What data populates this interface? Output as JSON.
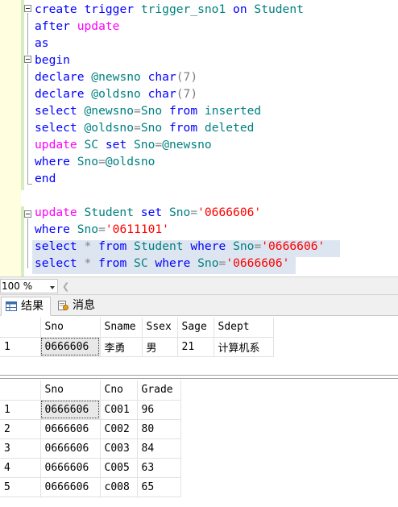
{
  "editor": {
    "lines": [
      [
        {
          "t": "create",
          "c": "kw"
        },
        {
          "t": " ",
          "c": ""
        },
        {
          "t": "trigger",
          "c": "kw"
        },
        {
          "t": " trigger_sno1 ",
          "c": "tl"
        },
        {
          "t": "on",
          "c": "kw"
        },
        {
          "t": " Student",
          "c": "tl"
        }
      ],
      [
        {
          "t": "after",
          "c": "kw"
        },
        {
          "t": " ",
          "c": ""
        },
        {
          "t": "update",
          "c": "pk"
        }
      ],
      [
        {
          "t": "as",
          "c": "kw"
        }
      ],
      [
        {
          "t": "begin",
          "c": "kw"
        }
      ],
      [
        {
          "t": "declare",
          "c": "kw"
        },
        {
          "t": " @newsno ",
          "c": "tl"
        },
        {
          "t": "char",
          "c": "kw"
        },
        {
          "t": "(7)",
          "c": "gy"
        }
      ],
      [
        {
          "t": "declare",
          "c": "kw"
        },
        {
          "t": " @oldsno ",
          "c": "tl"
        },
        {
          "t": "char",
          "c": "kw"
        },
        {
          "t": "(7)",
          "c": "gy"
        }
      ],
      [
        {
          "t": "select",
          "c": "kw"
        },
        {
          "t": " @newsno",
          "c": "tl"
        },
        {
          "t": "=",
          "c": "gy"
        },
        {
          "t": "Sno ",
          "c": "tl"
        },
        {
          "t": "from",
          "c": "kw"
        },
        {
          "t": " inserted",
          "c": "tl"
        }
      ],
      [
        {
          "t": "select",
          "c": "kw"
        },
        {
          "t": " @oldsno",
          "c": "tl"
        },
        {
          "t": "=",
          "c": "gy"
        },
        {
          "t": "Sno ",
          "c": "tl"
        },
        {
          "t": "from",
          "c": "kw"
        },
        {
          "t": " deleted",
          "c": "tl"
        }
      ],
      [
        {
          "t": "update",
          "c": "pk"
        },
        {
          "t": " SC ",
          "c": "tl"
        },
        {
          "t": "set",
          "c": "kw"
        },
        {
          "t": " Sno",
          "c": "tl"
        },
        {
          "t": "=",
          "c": "gy"
        },
        {
          "t": "@newsno",
          "c": "tl"
        }
      ],
      [
        {
          "t": "where",
          "c": "kw"
        },
        {
          "t": " Sno",
          "c": "tl"
        },
        {
          "t": "=",
          "c": "gy"
        },
        {
          "t": "@oldsno",
          "c": "tl"
        }
      ],
      [
        {
          "t": "end",
          "c": "kw"
        }
      ],
      [],
      [
        {
          "t": "update",
          "c": "pk"
        },
        {
          "t": " Student ",
          "c": "tl"
        },
        {
          "t": "set",
          "c": "kw"
        },
        {
          "t": " Sno",
          "c": "tl"
        },
        {
          "t": "=",
          "c": "gy"
        },
        {
          "t": "'0666606'",
          "c": "st"
        }
      ],
      [
        {
          "t": "where",
          "c": "kw"
        },
        {
          "t": " Sno",
          "c": "tl"
        },
        {
          "t": "=",
          "c": "gy"
        },
        {
          "t": "'0611101'",
          "c": "st"
        }
      ],
      [
        {
          "t": "select",
          "c": "kw"
        },
        {
          "t": " ",
          "c": ""
        },
        {
          "t": "*",
          "c": "gy"
        },
        {
          "t": " ",
          "c": ""
        },
        {
          "t": "from",
          "c": "kw"
        },
        {
          "t": " Student ",
          "c": "tl"
        },
        {
          "t": "where",
          "c": "kw"
        },
        {
          "t": " Sno",
          "c": "tl"
        },
        {
          "t": "=",
          "c": "gy"
        },
        {
          "t": "'0666606'",
          "c": "st"
        }
      ],
      [
        {
          "t": "select",
          "c": "kw"
        },
        {
          "t": " ",
          "c": ""
        },
        {
          "t": "*",
          "c": "gy"
        },
        {
          "t": " ",
          "c": ""
        },
        {
          "t": "from",
          "c": "kw"
        },
        {
          "t": " SC ",
          "c": "tl"
        },
        {
          "t": "where",
          "c": "kw"
        },
        {
          "t": " Sno",
          "c": "tl"
        },
        {
          "t": "=",
          "c": "gy"
        },
        {
          "t": "'0666606'",
          "c": "st"
        }
      ]
    ]
  },
  "zoom": {
    "value": "100 %"
  },
  "tabs": {
    "results": "结果",
    "messages": "消息"
  },
  "grid1": {
    "columns": [
      "Sno",
      "Sname",
      "Ssex",
      "Sage",
      "Sdept"
    ],
    "rows": [
      {
        "n": "1",
        "cells": [
          "0666606",
          "李勇",
          "男",
          "21",
          "计算机系"
        ]
      }
    ]
  },
  "grid2": {
    "columns": [
      "Sno",
      "Cno",
      "Grade"
    ],
    "rows": [
      {
        "n": "1",
        "cells": [
          "0666606",
          "C001",
          "96"
        ]
      },
      {
        "n": "2",
        "cells": [
          "0666606",
          "C002",
          "80"
        ]
      },
      {
        "n": "3",
        "cells": [
          "0666606",
          "C003",
          "84"
        ]
      },
      {
        "n": "4",
        "cells": [
          "0666606",
          "C005",
          "63"
        ]
      },
      {
        "n": "5",
        "cells": [
          "0666606",
          "c008",
          "65"
        ]
      }
    ]
  }
}
